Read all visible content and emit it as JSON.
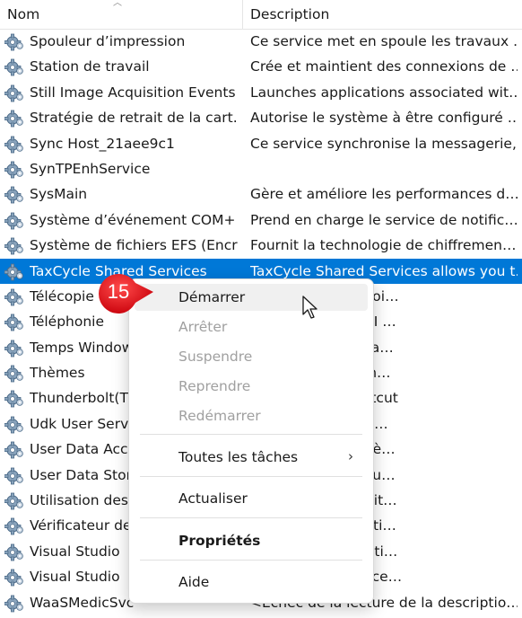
{
  "header": {
    "col_name": "Nom",
    "col_description": "Description"
  },
  "rows": [
    {
      "name": "Spouleur d’impression",
      "desc": "Ce service met en spoule les travaux …"
    },
    {
      "name": "Station de travail",
      "desc": "Crée et maintient des connexions de …"
    },
    {
      "name": "Still Image Acquisition Events",
      "desc": "Launches applications associated wit…"
    },
    {
      "name": "Stratégie de retrait de la cart…",
      "desc": "Autorise le système à être configuré …"
    },
    {
      "name": "Sync Host_21aee9c1",
      "desc": "Ce service synchronise la messagerie,…"
    },
    {
      "name": "SynTPEnhService",
      "desc": ""
    },
    {
      "name": "SysMain",
      "desc": "Gère et améliore les performances d…"
    },
    {
      "name": "Système d’événement COM+",
      "desc": "Prend en charge le service de notific…"
    },
    {
      "name": "Système de fichiers EFS (Encr…",
      "desc": "Fournit la technologie de chiffremen…"
    },
    {
      "name": "TaxCycle Shared Services",
      "desc": "TaxCycle Shared Services allows you t…"
    },
    {
      "name": "Télécopie",
      "desc": "voyer et de recevoi…"
    },
    {
      "name": "Téléphonie",
      "desc": "interface TAPI (API …"
    },
    {
      "name": "Temps Windows",
      "desc": "ronisation de la da…"
    },
    {
      "name": "Thèmes",
      "desc": "e de gestion de th…"
    },
    {
      "name": "Thunderbolt(T",
      "desc": "Peer to Peer Shortcut"
    },
    {
      "name": "Udk User Serv",
      "desc": "sants d'environne…"
    },
    {
      "name": "User Data Acc",
      "desc": "ations d'avoir accè…"
    },
    {
      "name": "User Data Stor",
      "desc": "des données de l'u…"
    },
    {
      "name": "Utilisation des",
      "desc": "nnées réseau, limit…"
    },
    {
      "name": "Vérificateur de",
      "desc": "nagements potenti…"
    },
    {
      "name": "Visual Studio",
      "desc": "ponsible for elevati…"
    },
    {
      "name": "Visual Studio",
      "desc": "n Collection Service…"
    },
    {
      "name": "WaaSMedicSvc",
      "desc": "<Echec de la lecture de la descriptio…"
    }
  ],
  "selected_row": 9,
  "menu": {
    "start": "Démarrer",
    "stop": "Arrêter",
    "pause": "Suspendre",
    "resume": "Reprendre",
    "restart": "Redémarrer",
    "all_tasks": "Toutes les tâches",
    "all_tasks_arrow": "›",
    "refresh": "Actualiser",
    "properties": "Propriétés",
    "help": "Aide"
  },
  "callout": {
    "number": "15",
    "color": "#e8121c"
  },
  "colors": {
    "selection": "#0078d7"
  }
}
